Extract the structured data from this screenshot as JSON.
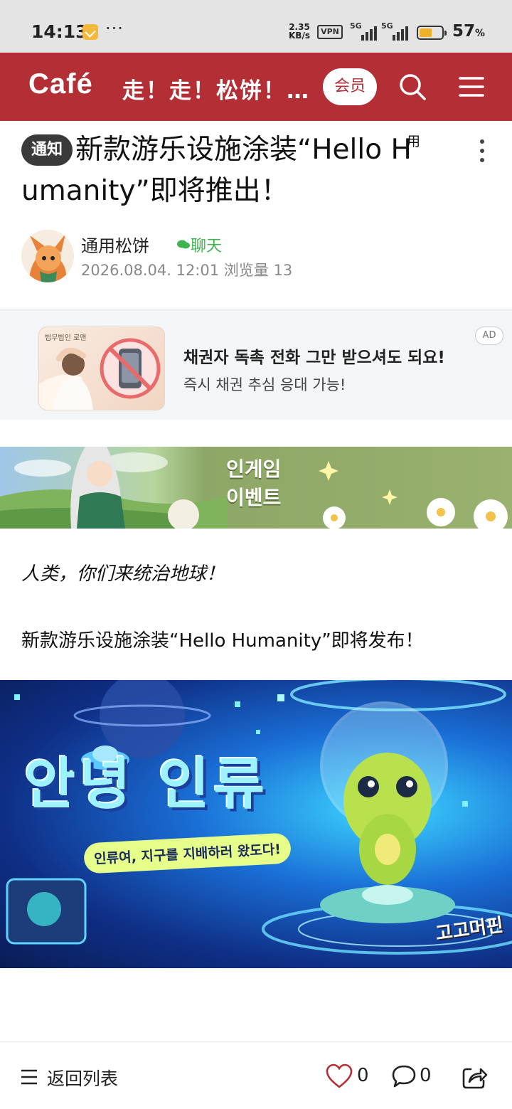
{
  "status_bar": {
    "time": "14:13",
    "more": "···",
    "net_speed_value": "2.35",
    "net_speed_unit": "KB/s",
    "vpn": "VPN",
    "sim1": "5G",
    "sim2": "5G",
    "battery_level": 57,
    "battery_text": "57",
    "battery_unit": "%"
  },
  "header": {
    "logo": "Café",
    "cafe_name": "走！走！松饼！…",
    "member_label": "会员",
    "search_icon": "search-icon",
    "menu_icon": "menu-icon"
  },
  "post": {
    "badge": "通知",
    "title": "新款游乐设施涂装“Hello H umanity”即将推出！",
    "title_superscript": "用",
    "author": "通用松饼",
    "chat_label": "聊天",
    "meta": "2026.08.04. 12:01 浏览量 13"
  },
  "ad": {
    "image_caption": "법무법인 로앤",
    "title": "채권자 독촉 전화 그만 받으셔도 되요!",
    "subtitle": "즉시 채권 추심 응대 가능!",
    "tag": "AD"
  },
  "event_banner": {
    "line1": "인게임",
    "line2": "이벤트"
  },
  "body": {
    "italic_line": "人类，你们来统治地球！",
    "line2": "新款游乐设施涂装“Hello Humanity”即将发布！"
  },
  "hero": {
    "title": "안녕 인류",
    "subtitle": "인류여, 지구를 지배하러 왔도다!",
    "logo": "고고머핀"
  },
  "bottom_bar": {
    "back_label": "返回列表",
    "like_count": "0",
    "comment_count": "0"
  },
  "colors": {
    "brand_red": "#b42f35",
    "chat_green": "#3fb34f",
    "badge_dark": "#3a3a3a"
  }
}
